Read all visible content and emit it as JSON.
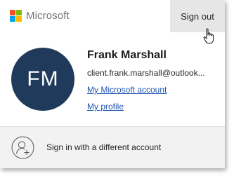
{
  "brand": {
    "name": "Microsoft",
    "logo_colors": [
      "#f25022",
      "#7fba00",
      "#00a4ef",
      "#ffb900"
    ]
  },
  "header": {
    "sign_out_label": "Sign out"
  },
  "account": {
    "initials": "FM",
    "avatar_color": "#1f3a5a",
    "name": "Frank Marshall",
    "email": "client.frank.marshall@outlook...",
    "links": {
      "account_label": "My Microsoft account",
      "profile_label": "My profile"
    }
  },
  "switch_account": {
    "label": "Sign in with a different account"
  },
  "colors": {
    "link": "#1f56b0",
    "sign_out_bg": "#e6e6e6",
    "footer_bg": "#f2f2f2"
  }
}
